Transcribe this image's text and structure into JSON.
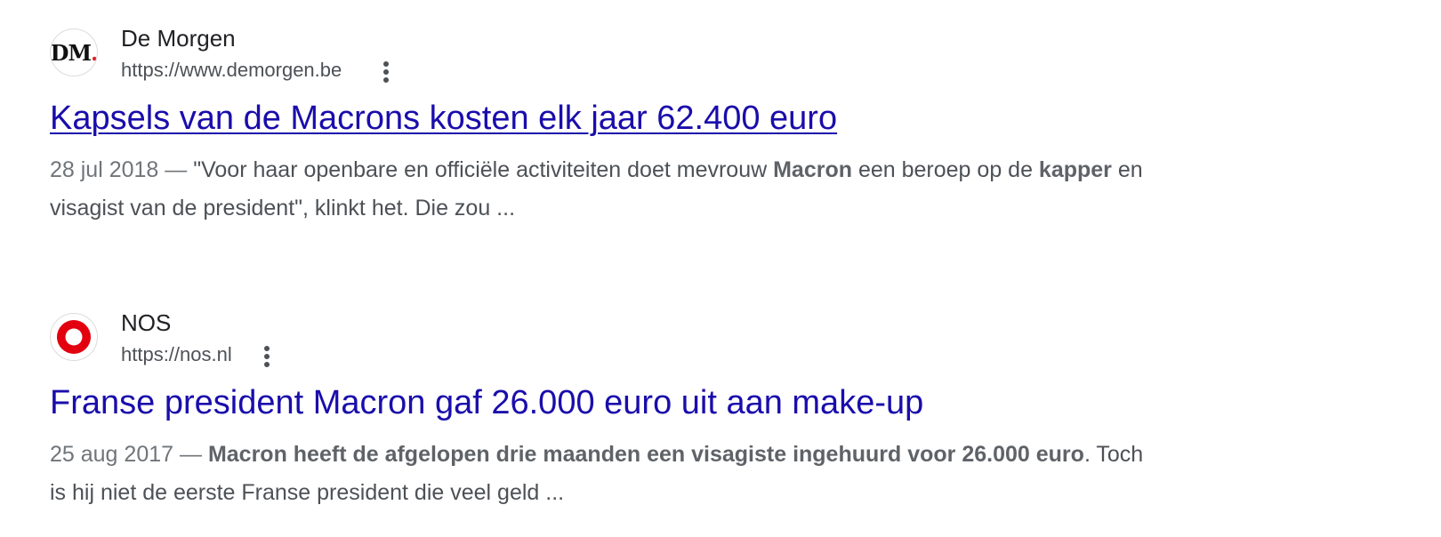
{
  "results": [
    {
      "site_name": "De Morgen",
      "url": "https://www.demorgen.be",
      "favicon_text": "DM",
      "favicon_dot": ".",
      "title": "Kapsels van de Macrons kosten elk jaar 62.400 euro",
      "date": "28 jul 2018",
      "date_sep": " — ",
      "snippet": [
        {
          "text": "\"Voor haar openbare en officiële activiteiten doet mevrouw ",
          "bold": false
        },
        {
          "text": "Macron",
          "bold": true
        },
        {
          "text": " een beroep op de ",
          "bold": false
        },
        {
          "text": "kapper",
          "bold": true
        },
        {
          "text": " en visagist van de president\", klinkt het. Die zou ...",
          "bold": false
        }
      ]
    },
    {
      "site_name": "NOS",
      "url": "https://nos.nl",
      "favicon_icon": "nos-ring-icon",
      "title": "Franse president Macron gaf 26.000 euro uit aan make-up",
      "date": "25 aug 2017",
      "date_sep": " — ",
      "snippet": [
        {
          "text": "Macron heeft de afgelopen drie maanden een visagiste ingehuurd voor 26.000 euro",
          "bold": true
        },
        {
          "text": ". Toch is hij niet de eerste Franse president die veel geld ...",
          "bold": false
        }
      ]
    }
  ],
  "colors": {
    "link": "#1a0dab",
    "text": "#4d5156",
    "nos_red": "#e3000f"
  }
}
